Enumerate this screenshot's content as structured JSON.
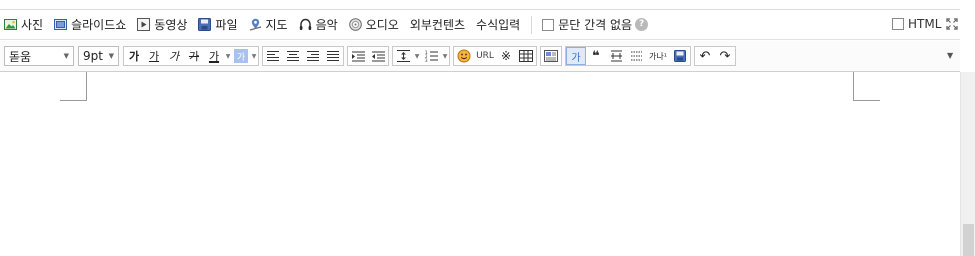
{
  "attach_toolbar": {
    "items": [
      {
        "label": "사진",
        "icon": "photo-icon"
      },
      {
        "label": "슬라이드쇼",
        "icon": "slideshow-icon"
      },
      {
        "label": "동영상",
        "icon": "video-icon"
      },
      {
        "label": "파일",
        "icon": "file-icon"
      },
      {
        "label": "지도",
        "icon": "map-icon"
      },
      {
        "label": "음악",
        "icon": "headphones-icon"
      },
      {
        "label": "오디오",
        "icon": "audio-disc-icon"
      },
      {
        "label": "외부컨텐츠",
        "icon": ""
      },
      {
        "label": "수식입력",
        "icon": ""
      }
    ],
    "no_paragraph_spacing_label": "문단 간격 없음",
    "help_glyph": "?",
    "html_label": "HTML"
  },
  "format_toolbar": {
    "font_family": "돋움",
    "font_size": "9pt",
    "bold_glyph": "가",
    "underline_glyph": "가",
    "italic_glyph": "가",
    "strike_glyph": "가",
    "text_color_glyph": "가",
    "bg_color_glyph": "가",
    "url_label": "URL",
    "special_char_glyph": "※",
    "quote_glyph": "❝",
    "box_glyph": "가",
    "sup_label": "가나¹",
    "undo_glyph": "↶",
    "redo_glyph": "↷"
  },
  "colors": {
    "accent_blue": "#3b6fc8",
    "text_color_red": "#c0392b",
    "bg_color_blue": "#a8c2f0",
    "emoticon_orange": "#f0a030"
  }
}
